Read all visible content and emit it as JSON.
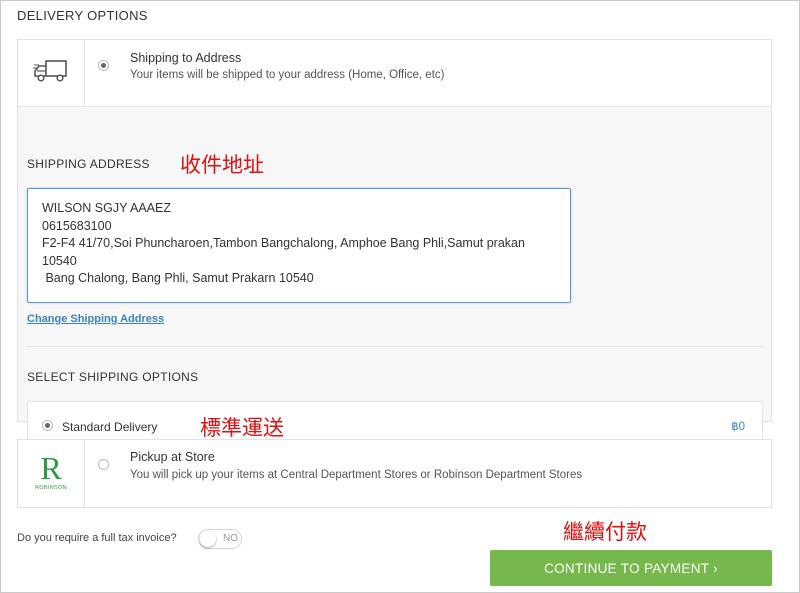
{
  "delivery": {
    "title": "DELIVERY OPTIONS",
    "shipping_option": {
      "icon": "delivery-truck-icon",
      "title": "Shipping to Address",
      "description": "Your items will be shipped to your address (Home, Office, etc)",
      "selected": true
    },
    "shipping_address": {
      "title": "SHIPPING ADDRESS",
      "annotation": "收件地址",
      "lines": [
        "WILSON SGJY AAAEZ",
        "0615683100",
        "F2-F4 41/70,Soi Phuncharoen,Tambon Bangchalong, Amphoe Bang Phli,Samut prakan",
        "10540",
        " Bang Chalong, Bang Phli, Samut Prakarn 10540"
      ],
      "change_link": "Change Shipping Address"
    },
    "shipping_options": {
      "title": "SELECT SHIPPING OPTIONS",
      "standard": {
        "label": "Standard Delivery",
        "price": "฿0",
        "selected": true
      },
      "annotation": "標準運送"
    },
    "store_option": {
      "logo_text": "ROBINSON",
      "title": "Pickup at Store",
      "description": "You will pick up your items at Central Department Stores or Robinson Department Stores",
      "selected": false
    }
  },
  "tax_invoice": {
    "question": "Do you require a full tax invoice?",
    "toggle_label": "NO",
    "enabled": false
  },
  "checkout": {
    "annotation": "繼續付款",
    "button_label": "CONTINUE TO PAYMENT ›"
  },
  "colors": {
    "accent_button": "#77b84d",
    "link": "#3a82c4",
    "annotation": "#e01010",
    "robinson_green": "#2e9a3e"
  }
}
